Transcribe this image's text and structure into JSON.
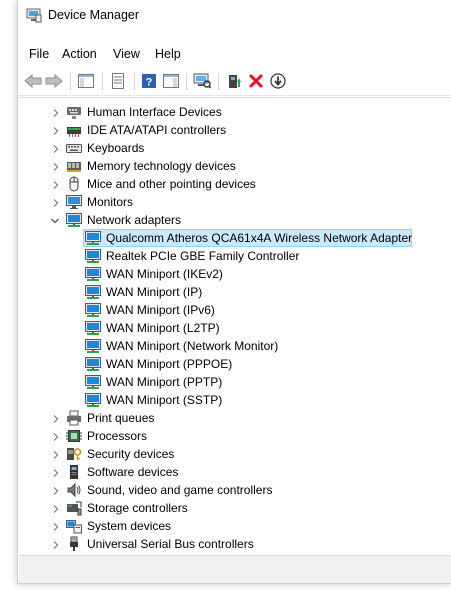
{
  "window": {
    "title": "Device Manager"
  },
  "menu": [
    "File",
    "Action",
    "View",
    "Help"
  ],
  "toolbar": {
    "buttons": [
      "back-icon",
      "forward-icon",
      "show-hide-console-tree-icon",
      "properties-icon",
      "help-icon",
      "action-pane-icon",
      "scan-hardware-icon",
      "update-driver-icon",
      "uninstall-icon",
      "disable-device-icon"
    ]
  },
  "tree": {
    "categories": [
      {
        "label": "Human Interface Devices",
        "icon": "hid-icon",
        "expanded": false
      },
      {
        "label": "IDE ATA/ATAPI controllers",
        "icon": "ide-icon",
        "expanded": false
      },
      {
        "label": "Keyboards",
        "icon": "keyboard-icon",
        "expanded": false
      },
      {
        "label": "Memory technology devices",
        "icon": "memory-icon",
        "expanded": false
      },
      {
        "label": "Mice and other pointing devices",
        "icon": "mouse-icon",
        "expanded": false
      },
      {
        "label": "Monitors",
        "icon": "monitor-icon",
        "expanded": false
      },
      {
        "label": "Network adapters",
        "icon": "network-icon",
        "expanded": true,
        "children": [
          "Qualcomm Atheros QCA61x4A Wireless Network Adapter",
          "Realtek PCIe GBE Family Controller",
          "WAN Miniport (IKEv2)",
          "WAN Miniport (IP)",
          "WAN Miniport (IPv6)",
          "WAN Miniport (L2TP)",
          "WAN Miniport (Network Monitor)",
          "WAN Miniport (PPPOE)",
          "WAN Miniport (PPTP)",
          "WAN Miniport (SSTP)"
        ],
        "selected_child": 0
      },
      {
        "label": "Print queues",
        "icon": "printer-icon",
        "expanded": false
      },
      {
        "label": "Processors",
        "icon": "processor-icon",
        "expanded": false
      },
      {
        "label": "Security devices",
        "icon": "security-icon",
        "expanded": false
      },
      {
        "label": "Software devices",
        "icon": "software-icon",
        "expanded": false
      },
      {
        "label": "Sound, video and game controllers",
        "icon": "sound-icon",
        "expanded": false
      },
      {
        "label": "Storage controllers",
        "icon": "storage-icon",
        "expanded": false
      },
      {
        "label": "System devices",
        "icon": "system-icon",
        "expanded": false
      },
      {
        "label": "Universal Serial Bus controllers",
        "icon": "usb-icon",
        "expanded": false
      }
    ]
  },
  "colors": {
    "selection_bg": "#cce8ff",
    "selection_border": "#99d1ff",
    "network_blue": "#1e88d8",
    "uninstall_red": "#e81123"
  }
}
